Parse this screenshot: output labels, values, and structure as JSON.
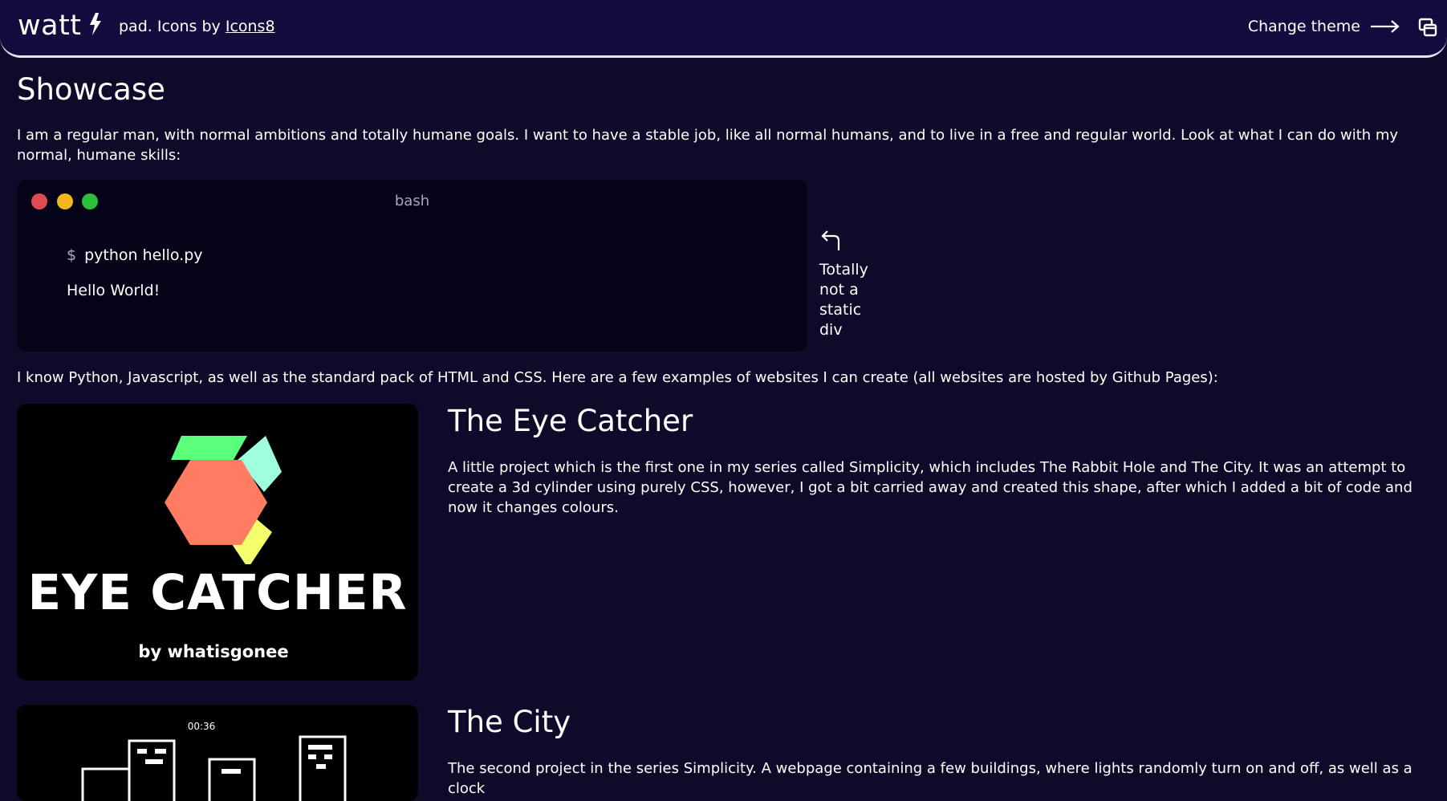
{
  "header": {
    "brand": "watt",
    "tagline_prefix": "pad. Icons by ",
    "tagline_link": "Icons8",
    "change_theme_label": "Change theme",
    "icons": {
      "brand": "lightning-bolt-icon",
      "arrow": "arrow-right-icon",
      "theme": "windows-icon"
    }
  },
  "main": {
    "title": "Showcase",
    "intro": "I am a regular man, with normal ambitions and totally humane goals. I want to have a stable job, like all normal humans, and to live in a free and regular world. Look at what I can do with my normal, humane skills:",
    "terminal": {
      "title": "bash",
      "prompt": "$",
      "command": "python hello.py",
      "output": "Hello World!",
      "dot_colors": [
        "#e04a55",
        "#f2b71b",
        "#2cc13c"
      ]
    },
    "side_note": "Totally not a static div",
    "skills": "I know Python, Javascript, as well as the standard pack of HTML and CSS. Here are a few examples of websites I can create (all websites are hosted by Github Pages):",
    "projects": [
      {
        "title": "The Eye Catcher",
        "description": "A little project which is the first one in my series called Simplicity, which includes The Rabbit Hole and The City. It was an attempt to create a 3d cylinder using purely CSS, however, I got a bit carried away and created this shape, after which I added a bit of code and now it changes colours.",
        "thumb_title": "EYE CATCHER",
        "thumb_byline": "by whatisgonee"
      },
      {
        "title": "The City",
        "description": "The second project in the series Simplicity. A webpage containing a few buildings, where lights randomly turn on and off, as well as a clock",
        "thumb_clock": "00:36"
      }
    ]
  },
  "colors": {
    "background": "#0f0a29",
    "header": "#140b3e",
    "terminal": "#050318",
    "hex_main": "#ff7b62",
    "hex_top": "#5cff7b",
    "hex_right": "#9ffde0",
    "hex_bottom": "#f5ff6e"
  }
}
